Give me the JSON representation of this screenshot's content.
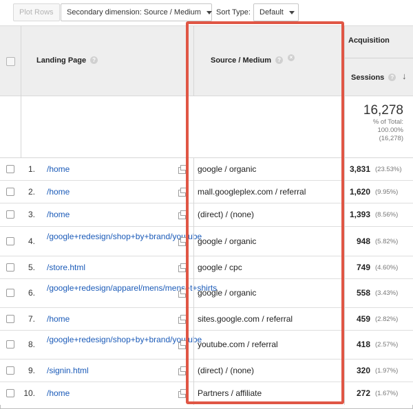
{
  "toolbar": {
    "plot_rows": "Plot Rows",
    "secondary_dimension": "Secondary dimension: Source / Medium",
    "sort_type_label": "Sort Type:",
    "sort_type_value": "Default"
  },
  "header": {
    "landing_page": "Landing Page",
    "source_medium": "Source / Medium",
    "acquisition": "Acquisition",
    "sessions": "Sessions",
    "help_glyph": "?",
    "remove_glyph": "×",
    "sort_glyph": "↓"
  },
  "totals": {
    "sessions": "16,278",
    "pct_label": "% of Total:",
    "pct_value": "100.00%",
    "total": "(16,278)"
  },
  "rows": [
    {
      "num": "1.",
      "page": "/home",
      "source": "google / organic",
      "sessions": "3,831",
      "pct": "(23.53%)"
    },
    {
      "num": "2.",
      "page": "/home",
      "source": "mall.googleplex.com / referral",
      "sessions": "1,620",
      "pct": "(9.95%)"
    },
    {
      "num": "3.",
      "page": "/home",
      "source": "(direct) / (none)",
      "sessions": "1,393",
      "pct": "(8.56%)"
    },
    {
      "num": "4.",
      "page": "/google+redesign/shop+by+brand/youtube",
      "source": "google / organic",
      "sessions": "948",
      "pct": "(5.82%)"
    },
    {
      "num": "5.",
      "page": "/store.html",
      "source": "google / cpc",
      "sessions": "749",
      "pct": "(4.60%)"
    },
    {
      "num": "6.",
      "page": "/google+redesign/apparel/mens/mens+t+shirts",
      "source": "google / organic",
      "sessions": "558",
      "pct": "(3.43%)"
    },
    {
      "num": "7.",
      "page": "/home",
      "source": "sites.google.com / referral",
      "sessions": "459",
      "pct": "(2.82%)"
    },
    {
      "num": "8.",
      "page": "/google+redesign/shop+by+brand/youtube",
      "source": "youtube.com / referral",
      "sessions": "418",
      "pct": "(2.57%)"
    },
    {
      "num": "9.",
      "page": "/signin.html",
      "source": "(direct) / (none)",
      "sessions": "320",
      "pct": "(1.97%)"
    },
    {
      "num": "10.",
      "page": "/home",
      "source": "Partners / affiliate",
      "sessions": "272",
      "pct": "(1.67%)"
    }
  ],
  "colors": {
    "highlight_border": "#e05645",
    "link": "#1a5ab8",
    "header_bg": "#eeeeee"
  }
}
